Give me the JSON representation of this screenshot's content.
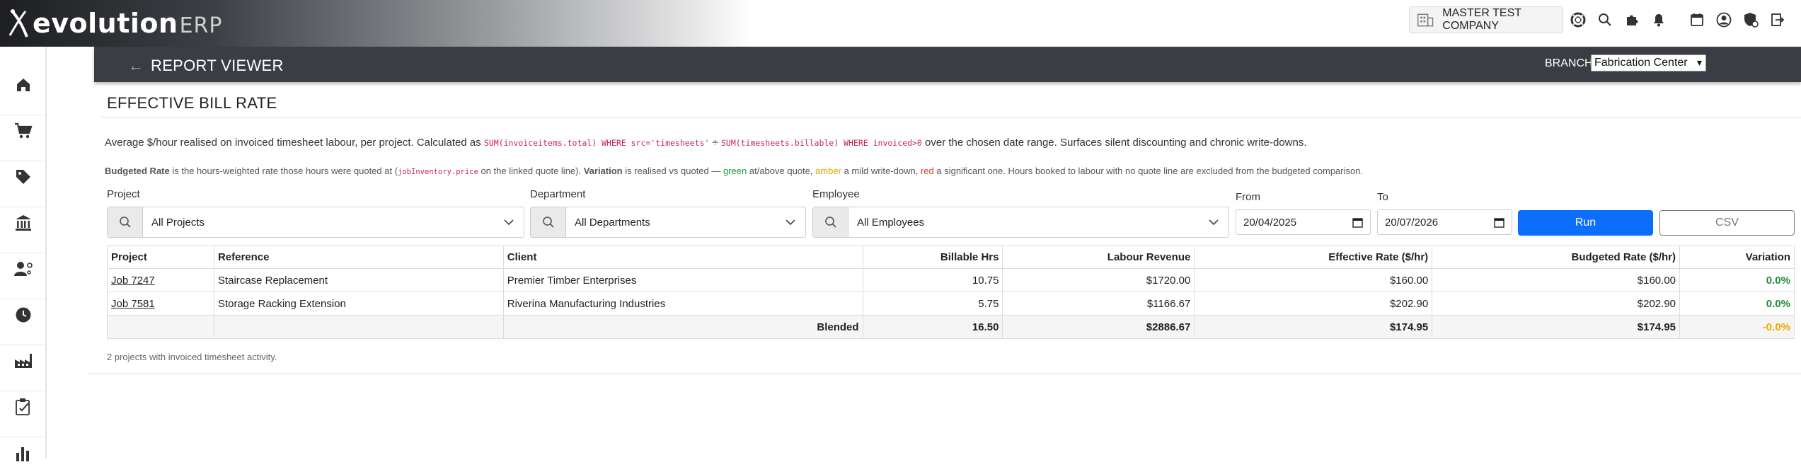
{
  "brand": {
    "name": "evolution",
    "suffix": "ERP"
  },
  "topbar": {
    "company": "MASTER TEST COMPANY",
    "icons": [
      "building-icon",
      "support-icon",
      "search-icon",
      "puzzle-icon",
      "bell-icon",
      "calendar-icon",
      "user-icon",
      "shield-icon",
      "logout-icon"
    ]
  },
  "sidebar": {
    "items": [
      "home-icon",
      "cart-icon",
      "tag-icon",
      "bank-icon",
      "user-settings-icon",
      "clock-icon",
      "factory-icon",
      "checklist-icon",
      "chart-icon"
    ]
  },
  "report_header": {
    "title": "REPORT VIEWER",
    "branch_label": "BRANCH:",
    "branch_value": "Fabrication Center"
  },
  "page": {
    "title": "EFFECTIVE BILL RATE",
    "desc1_a": "Average $/hour realised on invoiced timesheet labour, per project. Calculated as ",
    "desc1_code1": "SUM(invoiceitems.total) WHERE src='timesheets'",
    "desc1_div": " ÷ ",
    "desc1_code2": "SUM(timesheets.billable) WHERE invoiced>0",
    "desc1_b": " over the chosen date range. Surfaces silent discounting and chronic write-downs.",
    "desc2_bold1": "Budgeted Rate",
    "desc2_a": " is the hours-weighted rate those hours were quoted at (",
    "desc2_code": "jobInventory.price",
    "desc2_b": " on the linked quote line). ",
    "desc2_bold2": "Variation",
    "desc2_c": " is realised vs quoted — ",
    "desc2_green": "green",
    "desc2_d": " at/above quote, ",
    "desc2_amber": "amber",
    "desc2_e": " a mild write-down, ",
    "desc2_red": "red",
    "desc2_f": " a significant one. Hours booked to labour with no quote line are excluded from the budgeted comparison."
  },
  "filters": {
    "project_label": "Project",
    "project_value": "All Projects",
    "department_label": "Department",
    "department_value": "All Departments",
    "employee_label": "Employee",
    "employee_value": "All Employees",
    "from_label": "From",
    "from_value": "20/04/2025",
    "to_label": "To",
    "to_value": "20/07/2026",
    "run_label": "Run",
    "csv_label": "CSV"
  },
  "table": {
    "headers": [
      "Project",
      "Reference",
      "Client",
      "Billable Hrs",
      "Labour Revenue",
      "Effective Rate ($/hr)",
      "Budgeted Rate ($/hr)",
      "Variation"
    ],
    "rows": [
      {
        "project": "Job 7247",
        "reference": "Staircase Replacement",
        "client": "Premier Timber Enterprises",
        "hours": "10.75",
        "revenue": "$1720.00",
        "effective": "$160.00",
        "budgeted": "$160.00",
        "variation": "0.0%"
      },
      {
        "project": "Job 7581",
        "reference": "Storage Racking Extension",
        "client": "Riverina Manufacturing Industries",
        "hours": "5.75",
        "revenue": "$1166.67",
        "effective": "$202.90",
        "budgeted": "$202.90",
        "variation": "0.0%"
      }
    ],
    "footer": {
      "label": "Blended",
      "hours": "16.50",
      "revenue": "$2886.67",
      "effective": "$174.95",
      "budgeted": "$174.95",
      "variation": "-0.0%"
    },
    "colors": {
      "variation_green": "#1f8a3a",
      "variation_amber": "#f0a800"
    }
  },
  "footnote": "2 projects with invoiced timesheet activity."
}
